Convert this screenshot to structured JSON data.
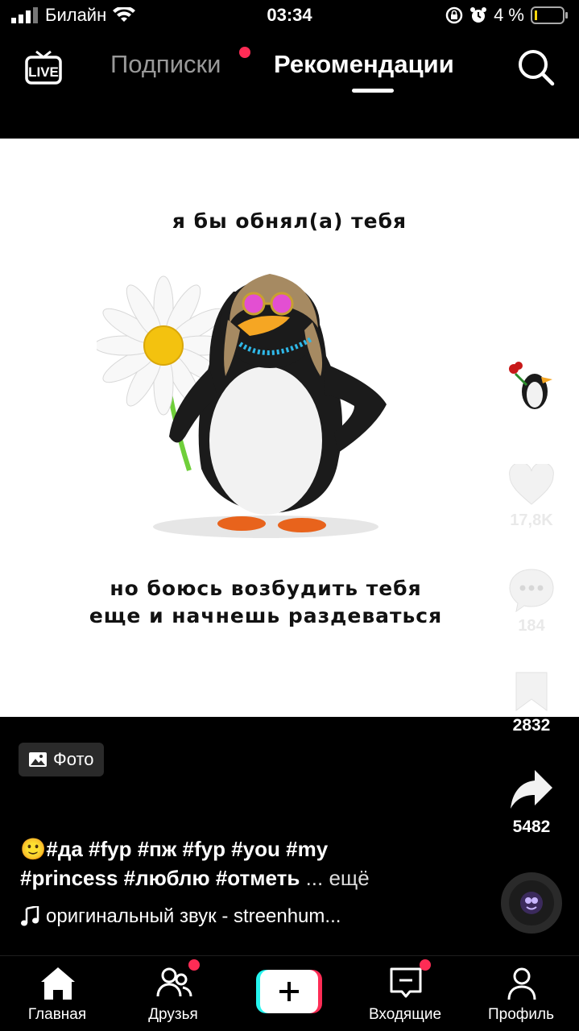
{
  "status_bar": {
    "carrier": "Билайн",
    "time": "03:34",
    "battery": "4 %"
  },
  "top_nav": {
    "live_label": "LIVE",
    "tab_following": "Подписки",
    "tab_for_you": "Рекомендации",
    "active_tab": "Рекомендации"
  },
  "post": {
    "caption_top": "я бы обнял(а) тебя",
    "caption_bottom_line1": "но боюсь возбудить тебя",
    "caption_bottom_line2": "еще и начнешь раздеваться",
    "likes": "17,8K",
    "comments": "184",
    "saves": "2832",
    "shares": "5482",
    "photo_badge": "Фото",
    "description_line1": "🙂#да #fyp #пж #fyp #you #my",
    "description_line2": "#princess #люблю #отметь",
    "more_label": "... ещё",
    "sound": "оригинальный звук - streenhum..."
  },
  "bottom_nav": {
    "home": "Главная",
    "friends": "Друзья",
    "inbox": "Входящие",
    "profile": "Профиль"
  },
  "colors": {
    "accent": "#fe2c55",
    "cyan": "#25f4ee",
    "background": "#000000"
  }
}
